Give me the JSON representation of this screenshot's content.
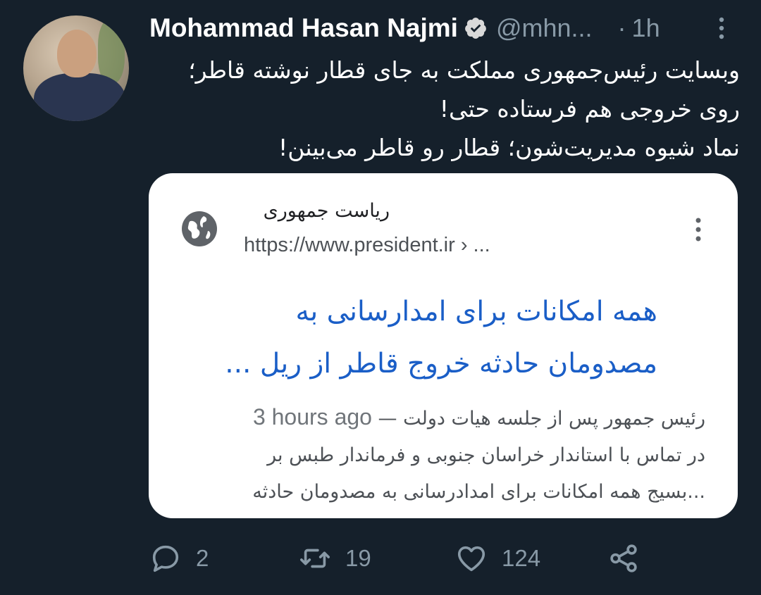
{
  "tweet": {
    "author_name": "Mohammad Hasan Najmi",
    "handle": "@mhn...",
    "separator": "·",
    "time": "1h",
    "text_lines": [
      "وبسایت رئیس‌جمهوری مملکت به جای قطار نوشته قاطر؛",
      "روی خروجی هم فرستاده حتی!",
      "نماد شیوه مدیریت‌شون؛ قطار رو قاطر می‌بینن!"
    ]
  },
  "card": {
    "site_name": "ریاست جمهوری",
    "site_url": "https://www.president.ir › ...",
    "title_lines": [
      "همه امکانات برای امدارسانی به",
      "مصدومان حادثه خروج قاطر از ریل ..."
    ],
    "snippet_age": "3 hours ago",
    "snippet_dash": "—",
    "snippet_first": "رئیس جمهور پس از جلسه هیات دولت",
    "snippet_lines": [
      "در تماس با استاندار خراسان جنوبی و فرماندار طبس بر",
      "...بسیج همه امکانات برای امدادرسانی به مصدومان حادثه"
    ]
  },
  "actions": {
    "replies": "2",
    "retweets": "19",
    "likes": "124"
  },
  "colors": {
    "background": "#15202b",
    "secondary_text": "#8899a6",
    "verified": "#d9d9d9",
    "link_blue": "#1a5ec7"
  }
}
